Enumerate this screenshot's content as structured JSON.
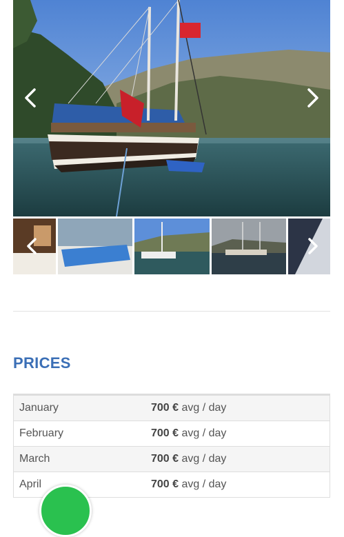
{
  "gallery": {
    "main_image": "sailing gulet anchored in a bay with a Turkish flag and mountains",
    "prev_icon": "chevron-left-icon",
    "next_icon": "chevron-right-icon"
  },
  "thumbnails": [
    {
      "name": "cabin-interior"
    },
    {
      "name": "deck-cushions"
    },
    {
      "name": "gulet-in-bay"
    },
    {
      "name": "gulet-at-sea"
    },
    {
      "name": "sail-closeup"
    }
  ],
  "prices": {
    "title": "PRICES",
    "rows": [
      {
        "month": "January",
        "amount": "700 €",
        "unit": "avg / day"
      },
      {
        "month": "February",
        "amount": "700 €",
        "unit": "avg / day"
      },
      {
        "month": "March",
        "amount": "700 €",
        "unit": "avg / day"
      },
      {
        "month": "April",
        "amount": "700 €",
        "unit": "avg / day"
      }
    ]
  },
  "colors": {
    "title_blue": "#3b6fb6",
    "whatsapp_green": "#2ac14f"
  },
  "chat_icon": "whatsapp-icon"
}
